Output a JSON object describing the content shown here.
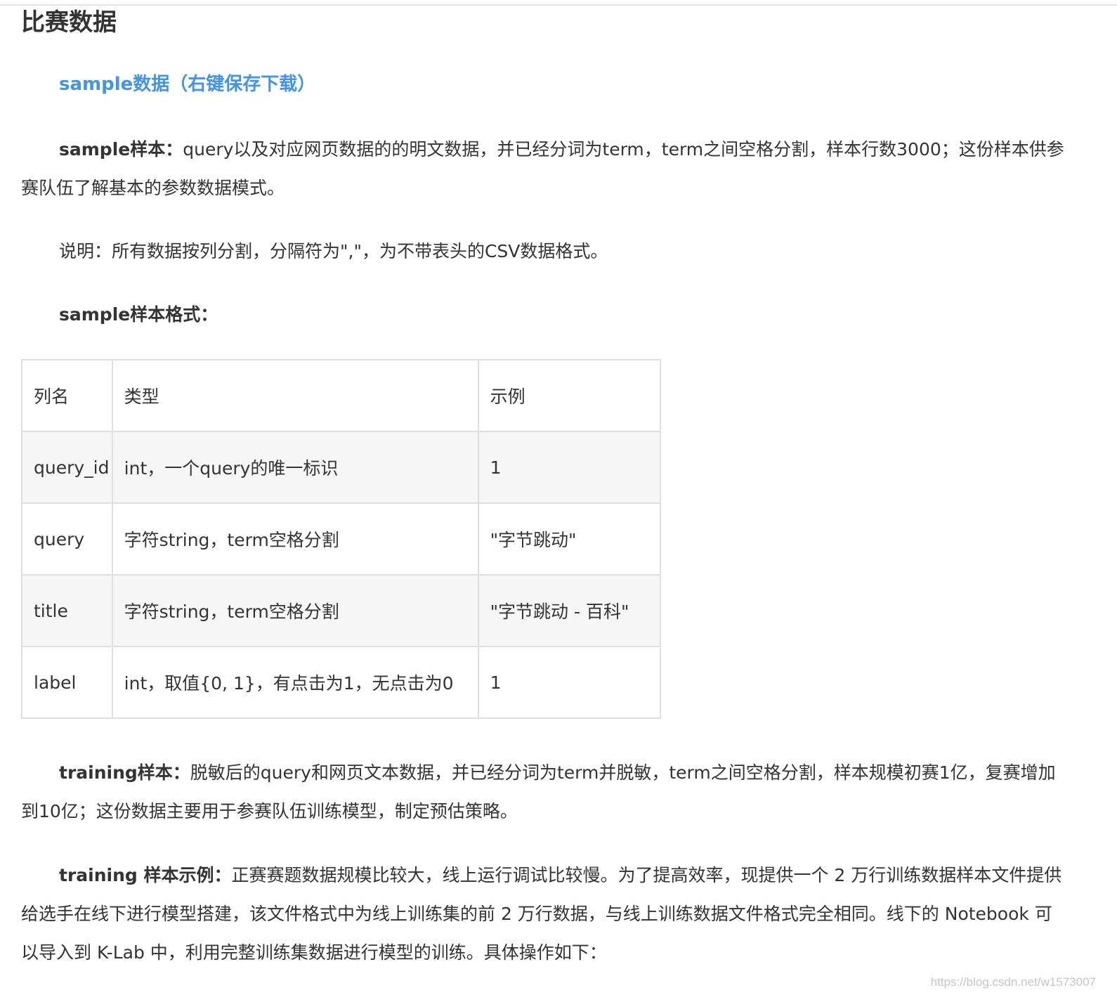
{
  "section_title": "比赛数据",
  "download_link": "sample数据（右键保存下载）",
  "sample_paragraph": {
    "label": "sample样本：",
    "text": "query以及对应网页数据的的明文数据，并已经分词为term，term之间空格分割，样本行数3000；这份样本供参赛队伍了解基本的参数数据模式。"
  },
  "note_paragraph": "说明：所有数据按列分割，分隔符为\",\"，为不带表头的CSV数据格式。",
  "format_heading": "sample样本格式：",
  "table": {
    "headers": [
      "列名",
      "类型",
      "示例"
    ],
    "rows": [
      [
        "query_id",
        "int，一个query的唯一标识",
        "1"
      ],
      [
        "query",
        "字符string，term空格分割",
        "\"字节跳动\""
      ],
      [
        "title",
        "字符string，term空格分割",
        "\"字节跳动 - 百科\""
      ],
      [
        "label",
        "int，取值{0, 1}，有点击为1，无点击为0",
        "1"
      ]
    ]
  },
  "training_paragraph": {
    "label": "training样本：",
    "text": "脱敏后的query和网页文本数据，并已经分词为term并脱敏，term之间空格分割，样本规模初赛1亿，复赛增加到10亿；这份数据主要用于参赛队伍训练模型，制定预估策略。"
  },
  "example_paragraph": {
    "label": "training 样本示例：",
    "text": "正赛赛题数据规模比较大，线上运行调试比较慢。为了提高效率，现提供一个 2 万行训练数据样本文件提供给选手在线下进行模型搭建，该文件格式中为线上训练集的前 2 万行数据，与线上训练数据文件格式完全相同。线下的 Notebook 可以导入到 K-Lab 中，利用完整训练集数据进行模型的训练。具体操作如下："
  },
  "watermark": "https://blog.csdn.net/w1573007"
}
